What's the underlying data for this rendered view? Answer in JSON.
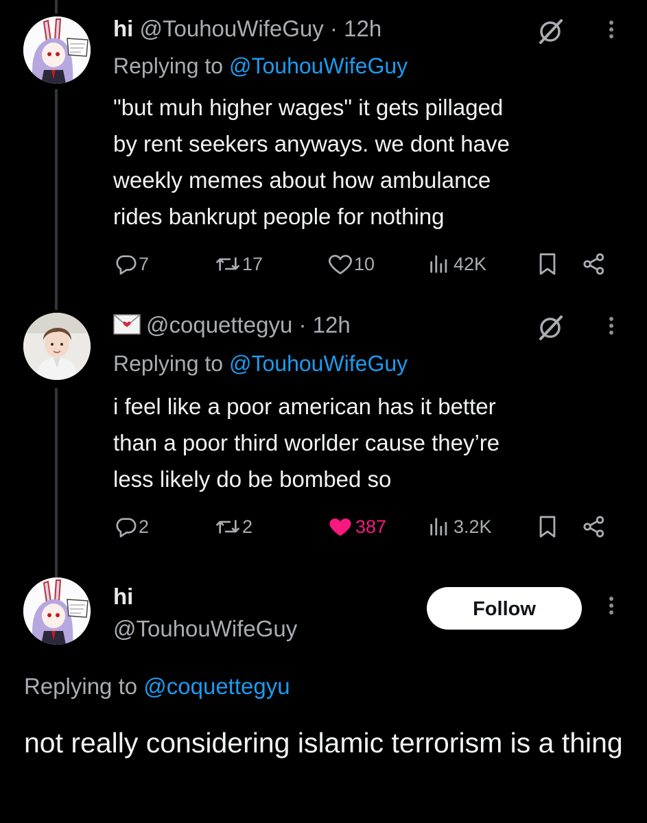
{
  "tweets": [
    {
      "name": "hi",
      "handle": "@TouhouWifeGuy",
      "dot": "·",
      "time": "12h",
      "replying_prefix": "Replying to ",
      "replying_to": "@TouhouWifeGuy",
      "text": "\"but muh higher wages\" it gets pillaged\nby rent seekers anyways. we dont have\nweekly memes about how ambulance\nrides bankrupt people for nothing",
      "replies": "7",
      "reposts": "17",
      "likes": "10",
      "views": "42K",
      "liked": false
    },
    {
      "name_icon": "mail-icon",
      "handle": "@coquettegyu",
      "dot": "·",
      "time": "12h",
      "replying_prefix": "Replying to ",
      "replying_to": "@TouhouWifeGuy",
      "text": "i feel like a poor american has it better\nthan a poor third worlder cause they’re\nless likely do be bombed so",
      "replies": "2",
      "reposts": "2",
      "likes": "387",
      "views": "3.2K",
      "liked": true
    }
  ],
  "main": {
    "name": "hi",
    "handle": "@TouhouWifeGuy",
    "follow_label": "Follow",
    "replying_prefix": "Replying to ",
    "replying_to": "@coquettegyu",
    "text": "not really considering islamic terrorism is a thing"
  },
  "icons": {
    "reply": "reply-icon",
    "repost": "repost-icon",
    "like": "heart-icon",
    "views": "views-icon",
    "bookmark": "bookmark-icon",
    "share": "share-icon",
    "grok": "grok-icon",
    "more": "more-icon"
  },
  "colors": {
    "background": "#000000",
    "text": "#e7e9ea",
    "secondary": "#a9adb1",
    "link": "#1d9bf0",
    "like": "#f91880"
  }
}
